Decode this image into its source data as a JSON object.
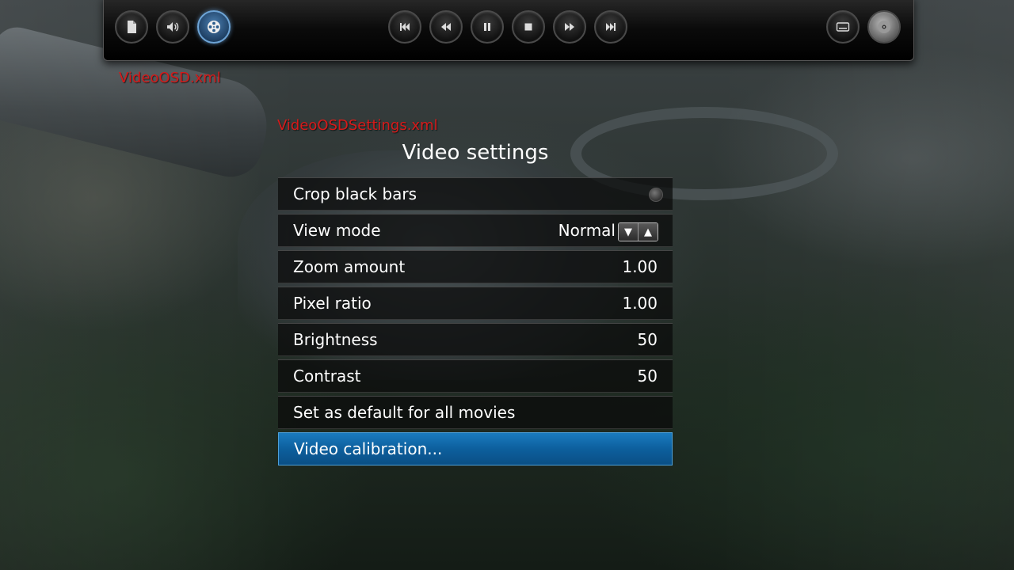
{
  "debug_labels": {
    "osd_file": "VideoOSD.xml",
    "settings_file": "VideoOSDSettings.xml"
  },
  "osd": {
    "left_buttons": [
      {
        "icon": "document-icon",
        "active": false
      },
      {
        "icon": "volume-icon",
        "active": false
      },
      {
        "icon": "film-reel-icon",
        "active": true
      }
    ],
    "transport_buttons": [
      {
        "icon": "skip-previous-icon"
      },
      {
        "icon": "rewind-icon"
      },
      {
        "icon": "pause-icon"
      },
      {
        "icon": "stop-icon"
      },
      {
        "icon": "fast-forward-icon"
      },
      {
        "icon": "skip-next-icon"
      }
    ],
    "right_buttons": [
      {
        "icon": "subtitles-icon"
      },
      {
        "icon": "disc-icon"
      }
    ]
  },
  "panel": {
    "title": "Video settings",
    "settings": [
      {
        "label": "Crop black bars",
        "type": "radio",
        "value": ""
      },
      {
        "label": "View mode",
        "type": "spin",
        "value": "Normal"
      },
      {
        "label": "Zoom amount",
        "type": "value",
        "value": "1.00"
      },
      {
        "label": "Pixel ratio",
        "type": "value",
        "value": "1.00"
      },
      {
        "label": "Brightness",
        "type": "value",
        "value": "50"
      },
      {
        "label": "Contrast",
        "type": "value",
        "value": "50"
      },
      {
        "label": "Set as default for all movies",
        "type": "button",
        "value": ""
      },
      {
        "label": "Video calibration...",
        "type": "button",
        "value": "",
        "focused": true
      }
    ],
    "spin_down_glyph": "▼",
    "spin_up_glyph": "▲"
  },
  "colors": {
    "focus_blue": "#0d5f9d",
    "debug_red": "#d61a1a",
    "active_osd_blue": "#4b7fb1"
  }
}
